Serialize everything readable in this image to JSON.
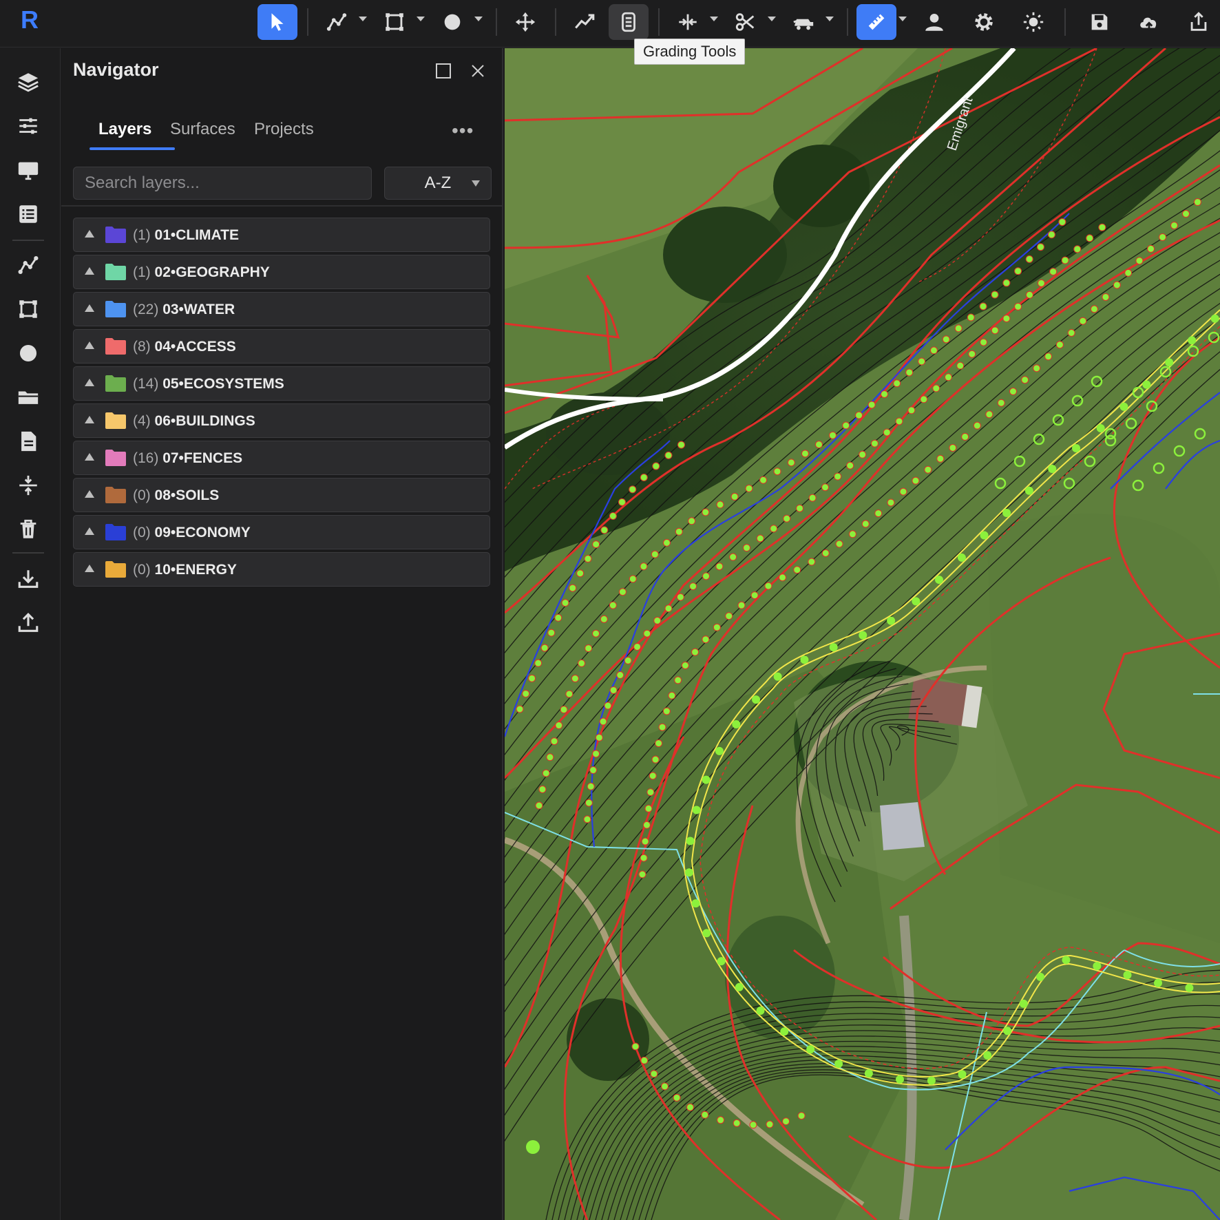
{
  "app": {
    "logo_letter": "R"
  },
  "toolbar": {
    "tooltip": "Grading Tools",
    "buttons": [
      {
        "name": "select-tool",
        "icon": "cursor-arrow-icon",
        "active": true
      },
      {
        "name": "polyline-tool",
        "icon": "polyline-icon"
      },
      {
        "name": "polygon-tool",
        "icon": "polygon-icon"
      },
      {
        "name": "circle-tool",
        "icon": "circle-icon"
      },
      {
        "name": "move-tool",
        "icon": "move-arrows-icon"
      },
      {
        "name": "profile-tool",
        "icon": "trend-line-icon"
      },
      {
        "name": "grading-tools",
        "icon": "grading-icon"
      },
      {
        "name": "split-tool",
        "icon": "split-horizontal-icon"
      },
      {
        "name": "cut-tool",
        "icon": "scissors-icon"
      },
      {
        "name": "earthmover-tool",
        "icon": "earthmover-icon"
      },
      {
        "name": "measure-tool",
        "icon": "ruler-icon",
        "active": true
      },
      {
        "name": "account",
        "icon": "user-icon"
      },
      {
        "name": "settings",
        "icon": "gear-icon"
      },
      {
        "name": "theme",
        "icon": "sun-icon"
      },
      {
        "name": "save",
        "icon": "save-icon"
      },
      {
        "name": "cloud-upload",
        "icon": "cloud-icon"
      },
      {
        "name": "export",
        "icon": "share-icon"
      }
    ]
  },
  "rail": {
    "items": [
      "layers-icon",
      "sliders-icon",
      "monitor-icon",
      "list-icon",
      "polyline-icon",
      "polygon-icon",
      "circle-icon",
      "folder-icon",
      "document-icon",
      "compress-icon",
      "trash-icon",
      "download-icon",
      "upload-icon"
    ]
  },
  "navigator": {
    "title": "Navigator",
    "tabs": [
      "Layers",
      "Surfaces",
      "Projects"
    ],
    "active_tab": "Layers",
    "more_label": "•••",
    "search_placeholder": "Search layers...",
    "sort_label": "A-Z",
    "layers": [
      {
        "count": "(1)",
        "name": "01•CLIMATE",
        "color": "#5b46d6"
      },
      {
        "count": "(1)",
        "name": "02•GEOGRAPHY",
        "color": "#6fd6a6"
      },
      {
        "count": "(22)",
        "name": "03•WATER",
        "color": "#4e93f0"
      },
      {
        "count": "(8)",
        "name": "04•ACCESS",
        "color": "#ef6b6b"
      },
      {
        "count": "(14)",
        "name": "05•ECOSYSTEMS",
        "color": "#6cae4e"
      },
      {
        "count": "(4)",
        "name": "06•BUILDINGS",
        "color": "#f6c76b"
      },
      {
        "count": "(16)",
        "name": "07•FENCES",
        "color": "#e27bbb"
      },
      {
        "count": "(0)",
        "name": "08•SOILS",
        "color": "#b06a3c"
      },
      {
        "count": "(0)",
        "name": "09•ECONOMY",
        "color": "#2a3fd6"
      },
      {
        "count": "(0)",
        "name": "10•ENERGY",
        "color": "#e9aa3a"
      }
    ]
  },
  "map": {
    "road_label": "Emigrant"
  },
  "colors": {
    "accent": "#3f7cf6",
    "contour_major": "#e0302a",
    "contour_minor": "#111111",
    "swale": "#f2e64a",
    "keypoint": "#8cf03c",
    "water": "#2a3fe0",
    "flow": "#7fe0e8",
    "road": "#ffffff"
  }
}
